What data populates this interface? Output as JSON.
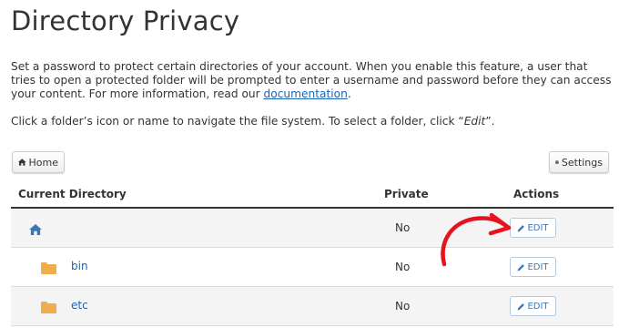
{
  "page": {
    "title": "Directory Privacy",
    "description_text": "Set a password to protect certain directories of your account. When you enable this feature, a user that tries to open a protected folder will be prompted to enter a username and password before they can access your content. For more information, read our ",
    "description_link": "documentation",
    "description_end": ".",
    "instruction_text": "Click a folder’s icon or name to navigate the file system. To select a folder, click “",
    "instruction_italic": "Edit",
    "instruction_end": "”."
  },
  "toolbar": {
    "home_label": "Home",
    "settings_label": "Settings"
  },
  "table": {
    "headers": {
      "directory": "Current Directory",
      "private": "Private",
      "actions": "Actions"
    },
    "rows": [
      {
        "name": "",
        "private": "No",
        "action": "EDIT",
        "icon": "home-icon"
      },
      {
        "name": "bin",
        "private": "No",
        "action": "EDIT",
        "icon": "folder-icon"
      },
      {
        "name": "etc",
        "private": "No",
        "action": "EDIT",
        "icon": "folder-icon"
      }
    ]
  },
  "colors": {
    "link": "#1b63b3",
    "folder": "#f0ad4e",
    "annotation_arrow": "#e8121f"
  }
}
